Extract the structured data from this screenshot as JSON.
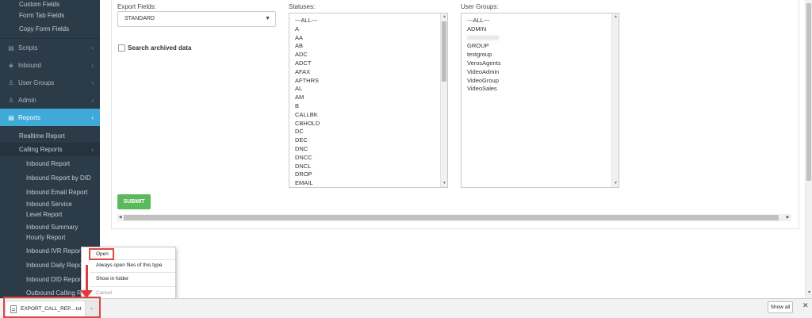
{
  "sidebar": {
    "top_items": [
      "Custom Fields",
      "Form Tab Fields",
      "Copy Form Fields"
    ],
    "main_items": [
      {
        "label": "Scripts",
        "icon": "document-icon"
      },
      {
        "label": "Inbound",
        "icon": "shield-icon"
      },
      {
        "label": "User Groups",
        "icon": "user-icon"
      },
      {
        "label": "Admin",
        "icon": "user-icon"
      }
    ],
    "active_item": {
      "label": "Reports",
      "icon": "document-icon"
    },
    "reports_children": [
      "Realtime Report",
      "Calling Reports"
    ],
    "calling_reports_children": [
      "Inbound Report",
      "Inbound Report by DID",
      "Inbound Email Report",
      "Inbound Service Level Report",
      "Inbound Summary Hourly Report",
      "Inbound IVR Report",
      "Inbound Daily Report",
      "Inbound DID Report",
      "Outbound Calling Re"
    ]
  },
  "form": {
    "export_fields_label": "Export Fields:",
    "export_fields_value": "STANDARD",
    "statuses_label": "Statuses:",
    "user_groups_label": "User Groups:",
    "search_archived_label": "Search archived data",
    "search_archived_checked": false,
    "submit_label": "SUBMIT",
    "statuses": [
      "---ALL---",
      "A",
      "AA",
      "AB",
      "ADC",
      "ADCT",
      "AFAX",
      "AFTHRS",
      "AL",
      "AM",
      "B",
      "CALLBK",
      "CBHOLD",
      "DC",
      "DEC",
      "DNC",
      "DNCC",
      "DNCL",
      "DROP",
      "EMAIL"
    ],
    "user_groups": [
      "---ALL---",
      "ADMIN",
      "",
      "GROUP",
      "testgroup",
      "VerosAgents",
      "VideoAdmin",
      "VideoGroup",
      "VideoSales"
    ]
  },
  "context_menu": {
    "items": [
      "Open",
      "Always open files of this type",
      "Show in folder",
      "Cancel"
    ]
  },
  "download_bar": {
    "file_name": "EXPORT_CALL_REP....txt",
    "show_all_label": "Show all"
  },
  "colors": {
    "sidebar_bg": "#2c3b48",
    "active_bg": "#3fa9d8",
    "submit_bg": "#5cb85c",
    "highlight": "#e04444"
  }
}
